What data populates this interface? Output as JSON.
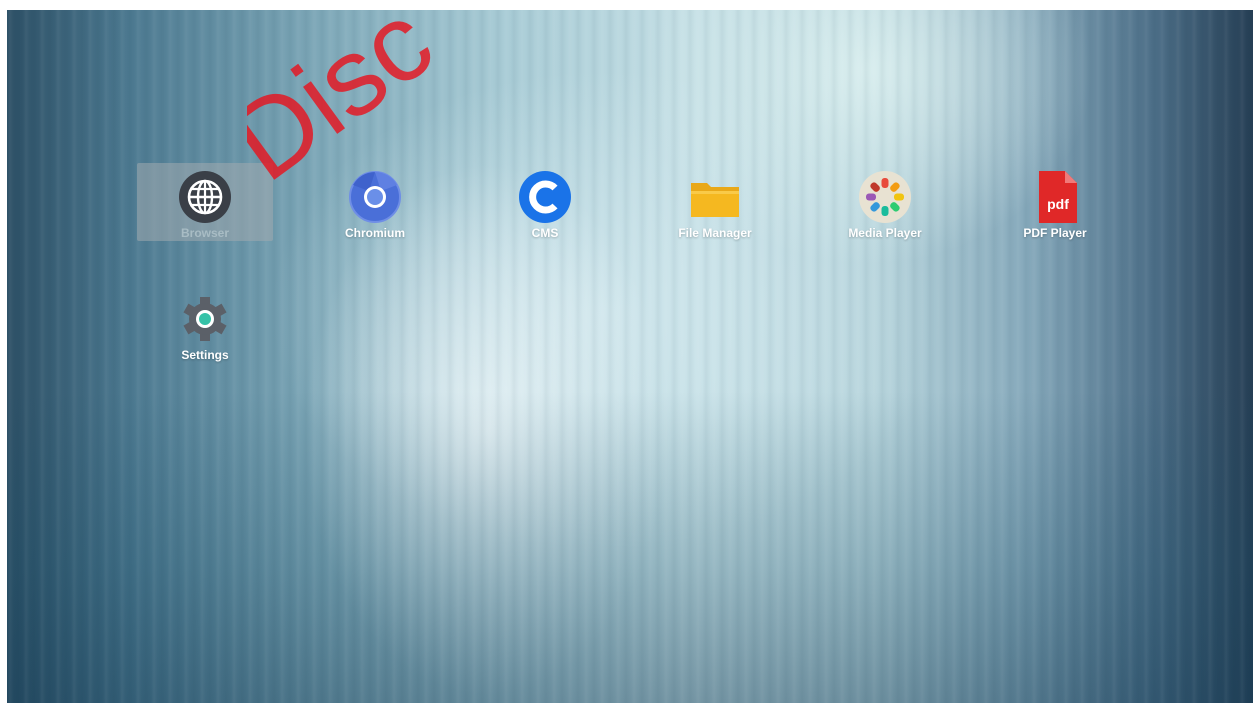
{
  "watermark": {
    "text": "Disc"
  },
  "apps": [
    {
      "id": "browser",
      "label": "Browser",
      "icon": "globe-icon",
      "selected": true
    },
    {
      "id": "chromium",
      "label": "Chromium",
      "icon": "chromium-icon",
      "selected": false
    },
    {
      "id": "cms",
      "label": "CMS",
      "icon": "cms-c-icon",
      "selected": false
    },
    {
      "id": "file-manager",
      "label": "File Manager",
      "icon": "folder-icon",
      "selected": false
    },
    {
      "id": "media-player",
      "label": "Media Player",
      "icon": "media-player-icon",
      "selected": false
    },
    {
      "id": "pdf-player",
      "label": "PDF Player",
      "icon": "pdf-icon",
      "icon_text": "pdf",
      "selected": false
    },
    {
      "id": "settings",
      "label": "Settings",
      "icon": "gear-icon",
      "selected": false
    }
  ],
  "colors": {
    "cms_blue": "#1a73e8",
    "chromium_blue": "#4a6fd8",
    "folder_yellow": "#f5b820",
    "pdf_red": "#e02828",
    "watermark_red": "#e6141e"
  }
}
